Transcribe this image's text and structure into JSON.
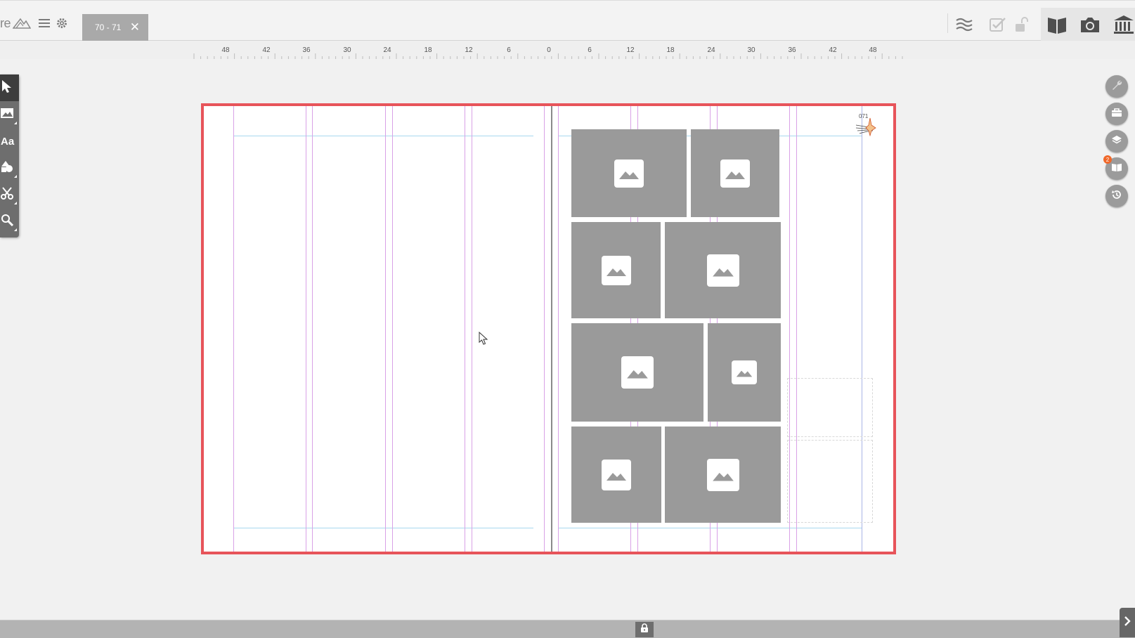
{
  "app": {
    "logo_text": "re"
  },
  "tab": {
    "label": "70 - 71",
    "close": "✕"
  },
  "ruler": {
    "labels": [
      "48",
      "42",
      "36",
      "30",
      "24",
      "18",
      "12",
      "6",
      "0",
      "6",
      "12",
      "18",
      "24",
      "30",
      "36",
      "42",
      "48"
    ]
  },
  "tools": [
    "select-tool",
    "image-tool",
    "text-tool",
    "shapes-tool",
    "cut-tool",
    "zoom-tool"
  ],
  "tools_text": {
    "text_tool": "Aa"
  },
  "page": {
    "number": "071"
  },
  "side_panel": {
    "notification_count": "2"
  },
  "colors": {
    "spread_border": "#e7545a",
    "column_guide": "#d9a1e6",
    "margin_guide": "#a8d8ee",
    "frame_fill": "#9a9a9a",
    "badge": "#f0682a"
  }
}
